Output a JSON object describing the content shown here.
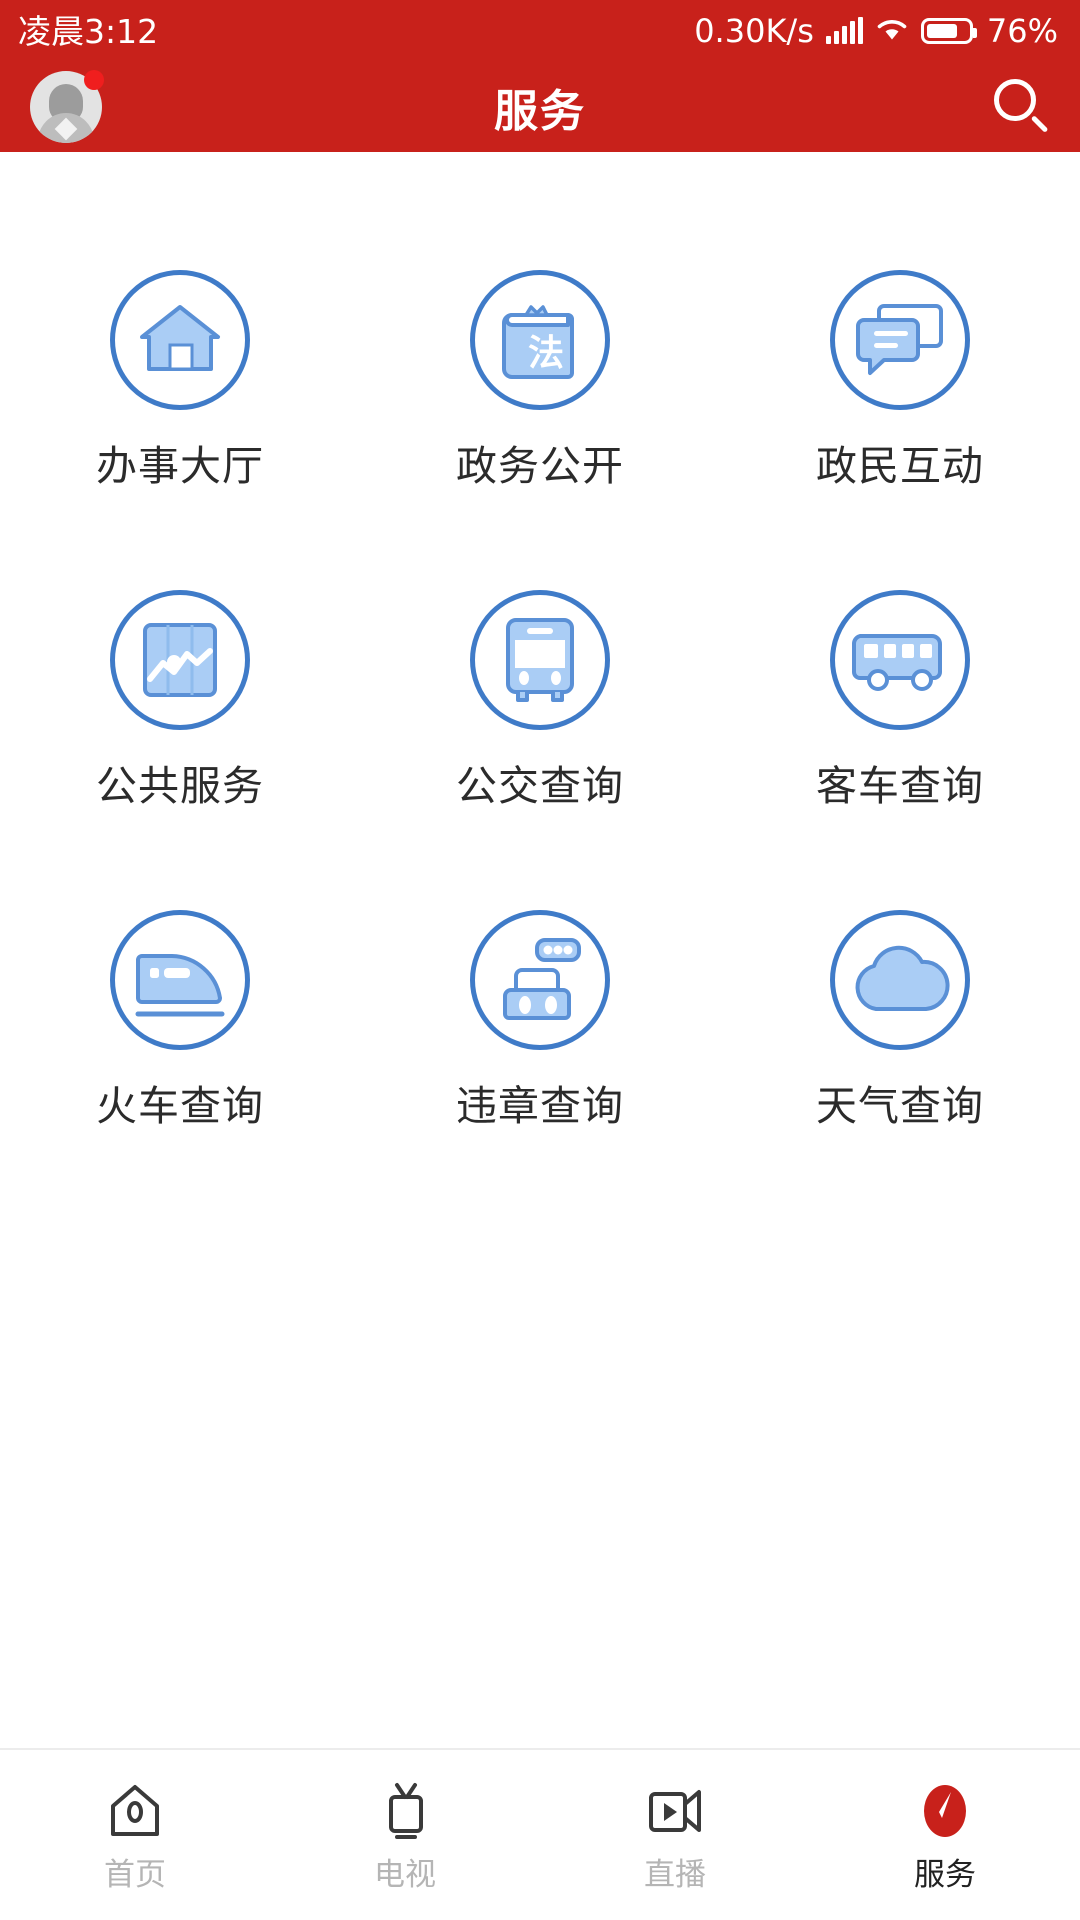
{
  "statusbar": {
    "time": "凌晨3:12",
    "network_speed": "0.30K/s",
    "battery_percent": "76%",
    "signal_icon": "signal-bars-icon",
    "wifi_icon": "wifi-icon",
    "battery_icon": "battery-icon"
  },
  "header": {
    "title": "服务",
    "avatar_icon": "avatar",
    "notification_badge": "",
    "search_icon": "search-icon",
    "background_color": "#C8211B"
  },
  "theme": {
    "brand_red": "#C8211B",
    "icon_blue_stroke": "#3f7bc8",
    "icon_blue_fill": "#aacdf5",
    "label_color": "#2b2b2b",
    "tab_inactive": "#b5b5b5",
    "tab_active": "#222222"
  },
  "grid": {
    "items": [
      {
        "label": "办事大厅",
        "icon": "house-icon"
      },
      {
        "label": "政务公开",
        "icon": "law-book-icon",
        "glyph": "法"
      },
      {
        "label": "政民互动",
        "icon": "chat-bubbles-icon"
      },
      {
        "label": "公共服务",
        "icon": "chart-panel-icon"
      },
      {
        "label": "公交查询",
        "icon": "bus-front-icon"
      },
      {
        "label": "客车查询",
        "icon": "coach-bus-icon"
      },
      {
        "label": "火车查询",
        "icon": "train-icon"
      },
      {
        "label": "违章查询",
        "icon": "traffic-violation-icon"
      },
      {
        "label": "天气查询",
        "icon": "cloud-icon"
      }
    ]
  },
  "tabbar": {
    "items": [
      {
        "label": "首页",
        "icon": "home-icon",
        "active": false
      },
      {
        "label": "电视",
        "icon": "tv-icon",
        "active": false
      },
      {
        "label": "直播",
        "icon": "live-video-icon",
        "active": false
      },
      {
        "label": "服务",
        "icon": "compass-icon",
        "active": true
      }
    ]
  }
}
